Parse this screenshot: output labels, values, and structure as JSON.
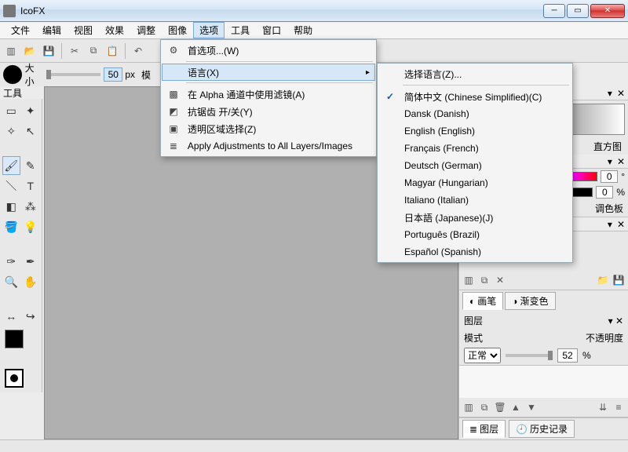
{
  "app": {
    "title": "IcoFX"
  },
  "menubar": {
    "items": [
      "文件",
      "编辑",
      "视图",
      "效果",
      "调整",
      "图像",
      "选项",
      "工具",
      "窗口",
      "帮助"
    ],
    "open_index": 6
  },
  "brush": {
    "size_label": "大小",
    "size_value": "50",
    "unit": "px",
    "mode_label": "模"
  },
  "toolbox": {
    "title": "工具"
  },
  "options_menu": {
    "preferences": "首选项...(W)",
    "language": "语言(X)",
    "alpha_filter": "在 Alpha 通道中使用滤镜(A)",
    "antialias": "抗锯齿 开/关(Y)",
    "transparent_sel": "透明区域选择(Z)",
    "apply_all": "Apply Adjustments to All Layers/Images"
  },
  "lang_menu": {
    "select": "选择语言(Z)...",
    "items": [
      {
        "label": "简体中文 (Chinese Simplified)(C)",
        "checked": true
      },
      {
        "label": "Dansk (Danish)",
        "checked": false
      },
      {
        "label": "English (English)",
        "checked": false
      },
      {
        "label": "Français (French)",
        "checked": false
      },
      {
        "label": "Deutsch (German)",
        "checked": false
      },
      {
        "label": "Magyar (Hungarian)",
        "checked": false
      },
      {
        "label": "Italiano (Italian)",
        "checked": false
      },
      {
        "label": "日本語 (Japanese)(J)",
        "checked": false
      },
      {
        "label": "Português (Brazil)",
        "checked": false
      },
      {
        "label": "Español (Spanish)",
        "checked": false
      }
    ]
  },
  "right": {
    "histogram": "直方图",
    "palette": "调色板",
    "hue_val": "0",
    "hue_deg": "°",
    "pct": "%",
    "brush_tab": "画笔",
    "gradient_tab": "渐变色",
    "layers_title": "图层",
    "mode_label": "模式",
    "opacity_label": "不透明度",
    "mode_value": "正常",
    "opacity_value": "52",
    "layers_tab": "图层",
    "history_tab": "历史记录"
  }
}
